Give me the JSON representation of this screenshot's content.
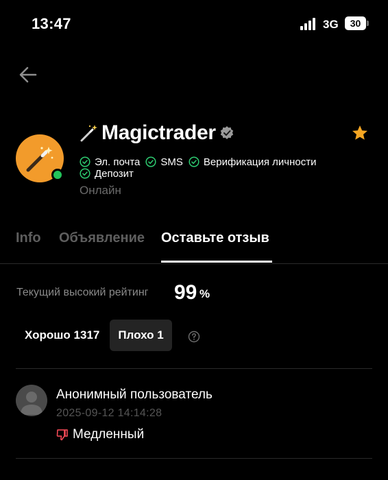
{
  "status_bar": {
    "time": "13:47",
    "network": "3G",
    "battery": "30"
  },
  "profile": {
    "name": "Magictrader",
    "verifications": [
      "Эл. почта",
      "SMS",
      "Верификация личности",
      "Депозит"
    ],
    "status": "Онлайн"
  },
  "tabs": [
    {
      "label": "Info"
    },
    {
      "label": "Объявление"
    },
    {
      "label": "Оставьте отзыв"
    }
  ],
  "rating": {
    "label": "Текущий высокий рейтинг",
    "value": "99",
    "unit": "%"
  },
  "filters": {
    "good": "Хорошо 1317",
    "bad": "Плохо 1"
  },
  "reviews": [
    {
      "author": "Анонимный пользователь",
      "date": "2025-09-12 14:14:28",
      "verdict": "Медленный"
    }
  ],
  "colors": {
    "background": "#000000",
    "avatar": "#f29b2b",
    "online": "#22c35a",
    "check": "#2ecc71",
    "star": "#f5a623",
    "negative": "#ff4d5a",
    "muted": "#8a8a8a"
  }
}
